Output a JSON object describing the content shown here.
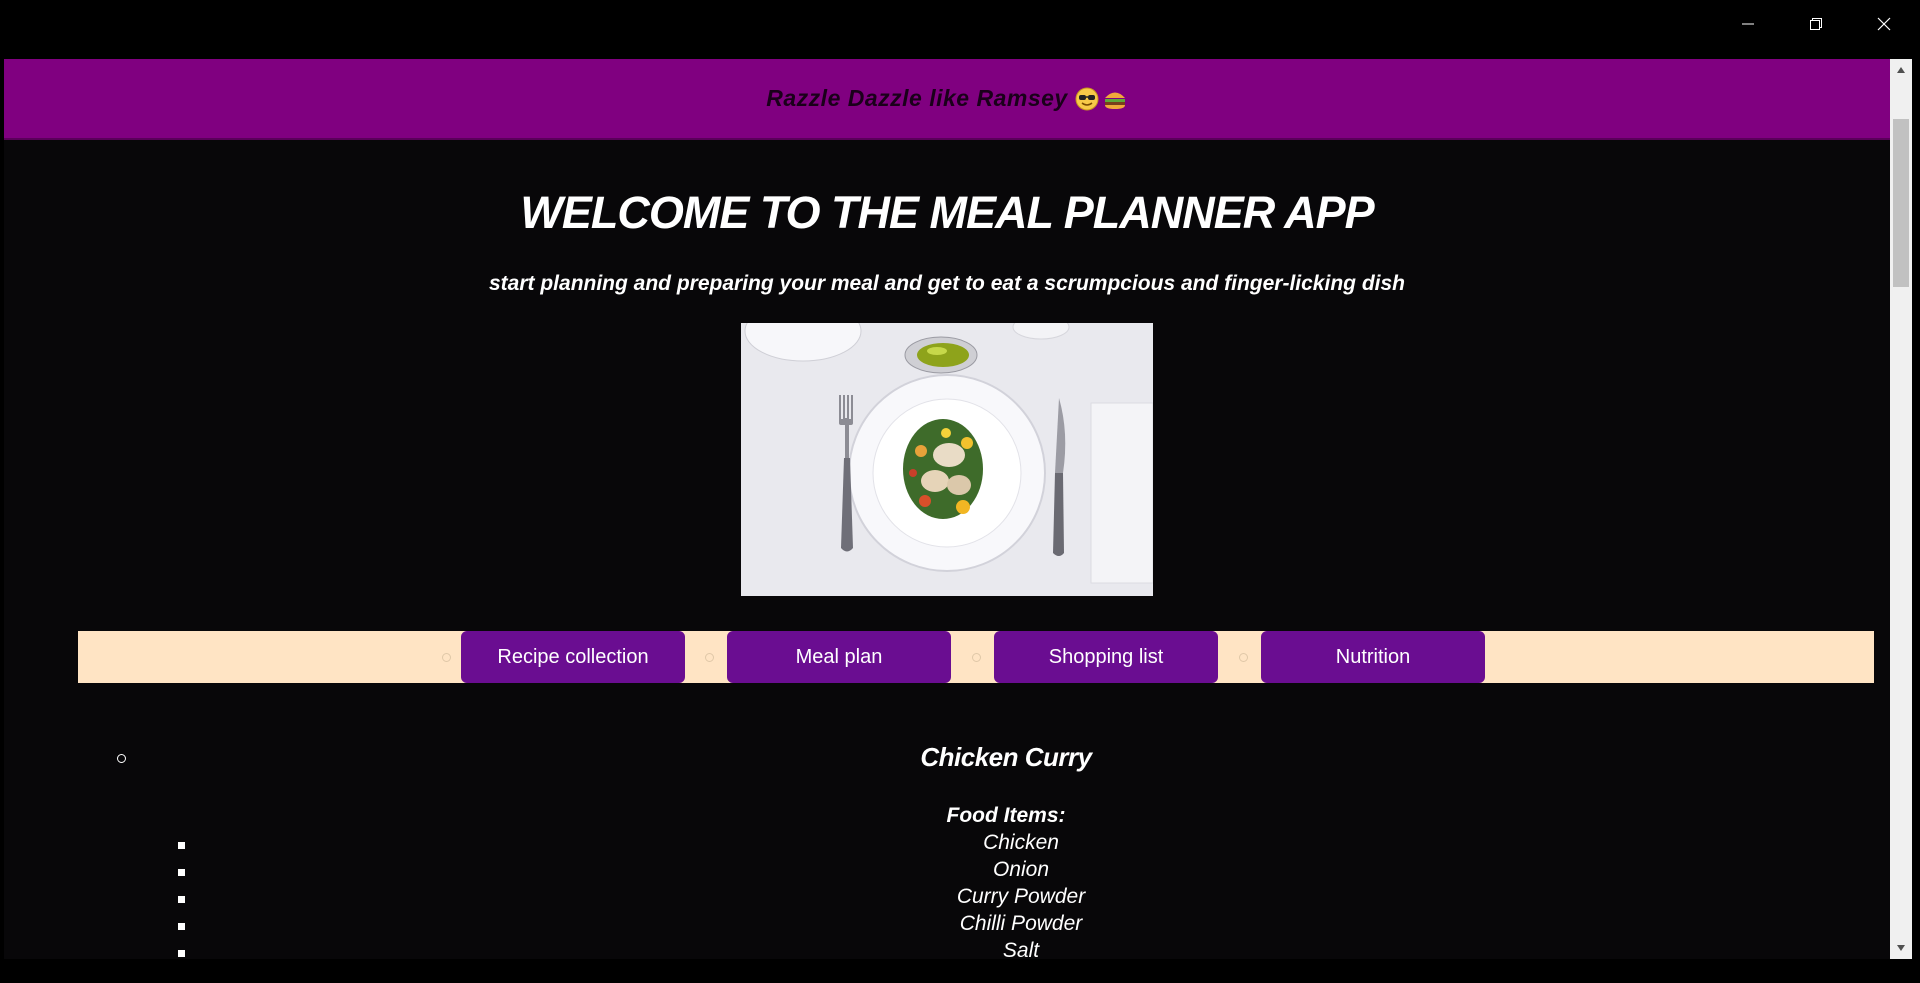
{
  "window": {
    "controls": [
      "minimize-icon",
      "restore-icon",
      "close-icon"
    ]
  },
  "header": {
    "brand": "Razzle Dazzle like Ramsey",
    "brand_emojis": [
      "sunglasses-emoji-icon",
      "burger-emoji-icon"
    ],
    "background_color": "#800080"
  },
  "hero": {
    "title": "WELCOME TO THE MEAL PLANNER APP",
    "subtitle": "start planning and preparing your meal and get to eat a scrumpcious and finger-licking dish"
  },
  "nav": {
    "background_color": "#ffe4c4",
    "button_color": "#6a0d91",
    "items": [
      {
        "label": "Recipe collection"
      },
      {
        "label": "Meal plan"
      },
      {
        "label": "Shopping list"
      },
      {
        "label": "Nutrition"
      }
    ]
  },
  "recipe": {
    "title": "Chicken Curry",
    "food_items_label": "Food Items:",
    "ingredients": [
      "Chicken",
      "Onion",
      "Curry Powder",
      "Chilli Powder",
      "Salt"
    ]
  }
}
